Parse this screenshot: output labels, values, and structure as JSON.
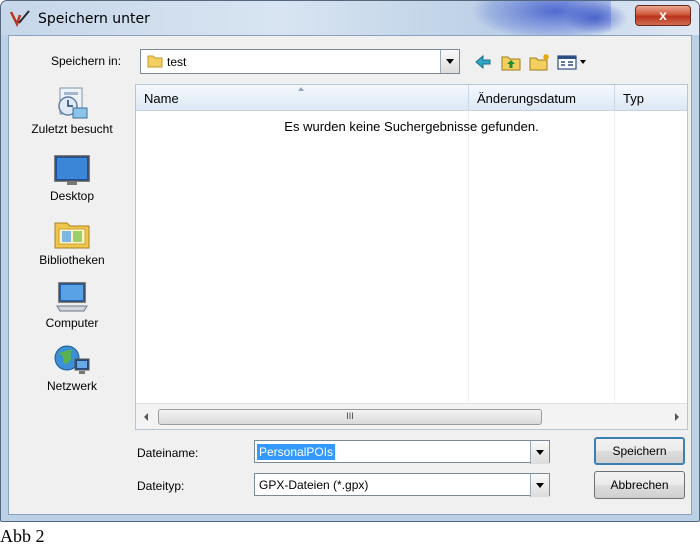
{
  "window": {
    "title": "Speichern unter",
    "close_label": "x"
  },
  "toolbar": {
    "save_in_label": "Speichern in:",
    "save_in_value": "test",
    "tools": [
      "back-icon",
      "up-folder-icon",
      "new-folder-icon",
      "view-menu-icon"
    ]
  },
  "places": [
    {
      "label": "Zuletzt besucht",
      "icon": "recent-places-icon"
    },
    {
      "label": "Desktop",
      "icon": "desktop-icon"
    },
    {
      "label": "Bibliotheken",
      "icon": "libraries-icon"
    },
    {
      "label": "Computer",
      "icon": "computer-icon"
    },
    {
      "label": "Netzwerk",
      "icon": "network-icon"
    }
  ],
  "filelist": {
    "columns": [
      "Name",
      "Änderungsdatum",
      "Typ"
    ],
    "empty_message": "Es wurden keine Suchergebnisse gefunden.",
    "scroll_thumb_label": "III"
  },
  "fields": {
    "filename_label": "Dateiname:",
    "filename_value": "PersonalPOIs",
    "filetype_label": "Dateityp:",
    "filetype_value": "GPX-Dateien (*.gpx)"
  },
  "buttons": {
    "save": "Speichern",
    "cancel": "Abbrechen"
  },
  "caption": "Abb 2"
}
